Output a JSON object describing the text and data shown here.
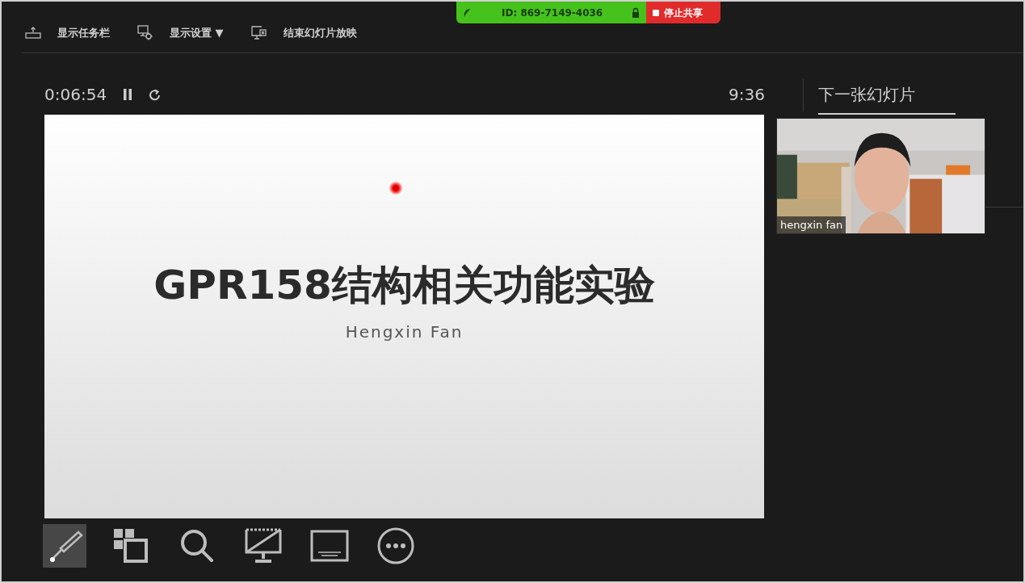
{
  "share_bar": {
    "meeting_id": "ID: 869-7149-4036",
    "stop_button": "停止共享"
  },
  "toolbar": [
    {
      "kind": "taskbar",
      "label": "显示任务栏"
    },
    {
      "kind": "display",
      "label": "显示设置 ▼"
    },
    {
      "kind": "end",
      "label": "结束幻灯片放映"
    }
  ],
  "timer": {
    "elapsed": "0:06:54",
    "clock": "9:36"
  },
  "slide": {
    "title": "GPR158结构相关功能实验",
    "subtitle": "Hengxin Fan"
  },
  "next_slide": {
    "label": "下一张幻灯片"
  },
  "video": {
    "kind": "picture",
    "name": "hengxin fan"
  },
  "tools": [
    {
      "kind": "pen",
      "selected": true
    },
    {
      "kind": "slides",
      "selected": false
    },
    {
      "kind": "zoom",
      "selected": false
    },
    {
      "kind": "black",
      "selected": false
    },
    {
      "kind": "subtitles",
      "selected": false
    },
    {
      "kind": "more",
      "selected": false
    }
  ]
}
